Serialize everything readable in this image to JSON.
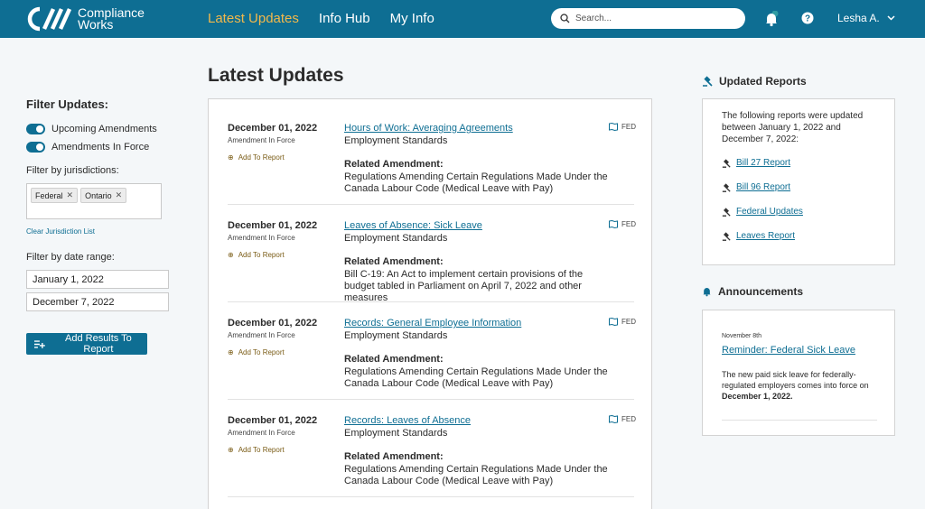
{
  "brand": {
    "line1": "Compliance",
    "line2": "Works"
  },
  "nav": {
    "items": [
      {
        "label": "Latest Updates"
      },
      {
        "label": "Info Hub"
      },
      {
        "label": "My Info"
      }
    ]
  },
  "search": {
    "placeholder": "Search..."
  },
  "user": {
    "name": "Lesha A."
  },
  "filters": {
    "heading": "Filter Updates:",
    "toggles": [
      {
        "label": "Upcoming Amendments"
      },
      {
        "label": "Amendments In Force"
      }
    ],
    "jurisdiction_label": "Filter by jurisdictions:",
    "jurisdictions": [
      "Federal",
      "Ontario"
    ],
    "clear_label": "Clear Jurisdiction List",
    "date_label": "Filter by date range:",
    "date_from": "January 1, 2022",
    "date_to": "December 7, 2022",
    "add_button": "Add Results To Report"
  },
  "main": {
    "title": "Latest Updates",
    "updates": [
      {
        "date": "December 01, 2022",
        "status": "Amendment In Force",
        "add": "Add To Report",
        "title": "Hours of Work: Averaging Agreements",
        "category": "Employment Standards",
        "related_label": "Related Amendment:",
        "related": "Regulations Amending Certain Regulations Made Under the Canada Labour Code (Medical Leave with Pay)",
        "jurisdiction": "FED"
      },
      {
        "date": "December 01, 2022",
        "status": "Amendment In Force",
        "add": "Add To Report",
        "title": "Leaves of Absence: Sick Leave",
        "category": "Employment Standards",
        "related_label": "Related Amendment:",
        "related": "Bill C-19: An Act to implement certain provisions of the budget tabled in Parliament on April 7, 2022 and other measures",
        "jurisdiction": "FED"
      },
      {
        "date": "December 01, 2022",
        "status": "Amendment In Force",
        "add": "Add To Report",
        "title": "Records: General Employee Information",
        "category": "Employment Standards",
        "related_label": "Related Amendment:",
        "related": "Regulations Amending Certain Regulations Made Under the Canada Labour Code (Medical Leave with Pay)",
        "jurisdiction": "FED"
      },
      {
        "date": "December 01, 2022",
        "status": "Amendment In Force",
        "add": "Add To Report",
        "title": "Records: Leaves of Absence",
        "category": "Employment Standards",
        "related_label": "Related Amendment:",
        "related": "Regulations Amending Certain Regulations Made Under the Canada Labour Code (Medical Leave with Pay)",
        "jurisdiction": "FED"
      }
    ]
  },
  "reports": {
    "heading": "Updated Reports",
    "intro": "The following reports were updated between January 1, 2022 and December 7, 2022:",
    "links": [
      "Bill 27 Report",
      "Bill 96 Report",
      "Federal Updates",
      "Leaves Report"
    ]
  },
  "announcements": {
    "heading": "Announcements",
    "date": "November 8th",
    "title": "Reminder: Federal Sick Leave",
    "body": "The new paid sick leave for federally-regulated employers comes into force on ",
    "body_bold": "December 1, 2022."
  },
  "colors": {
    "primary": "#0e6e93",
    "accent": "#f2b84b",
    "add_link": "#7a5c16"
  }
}
